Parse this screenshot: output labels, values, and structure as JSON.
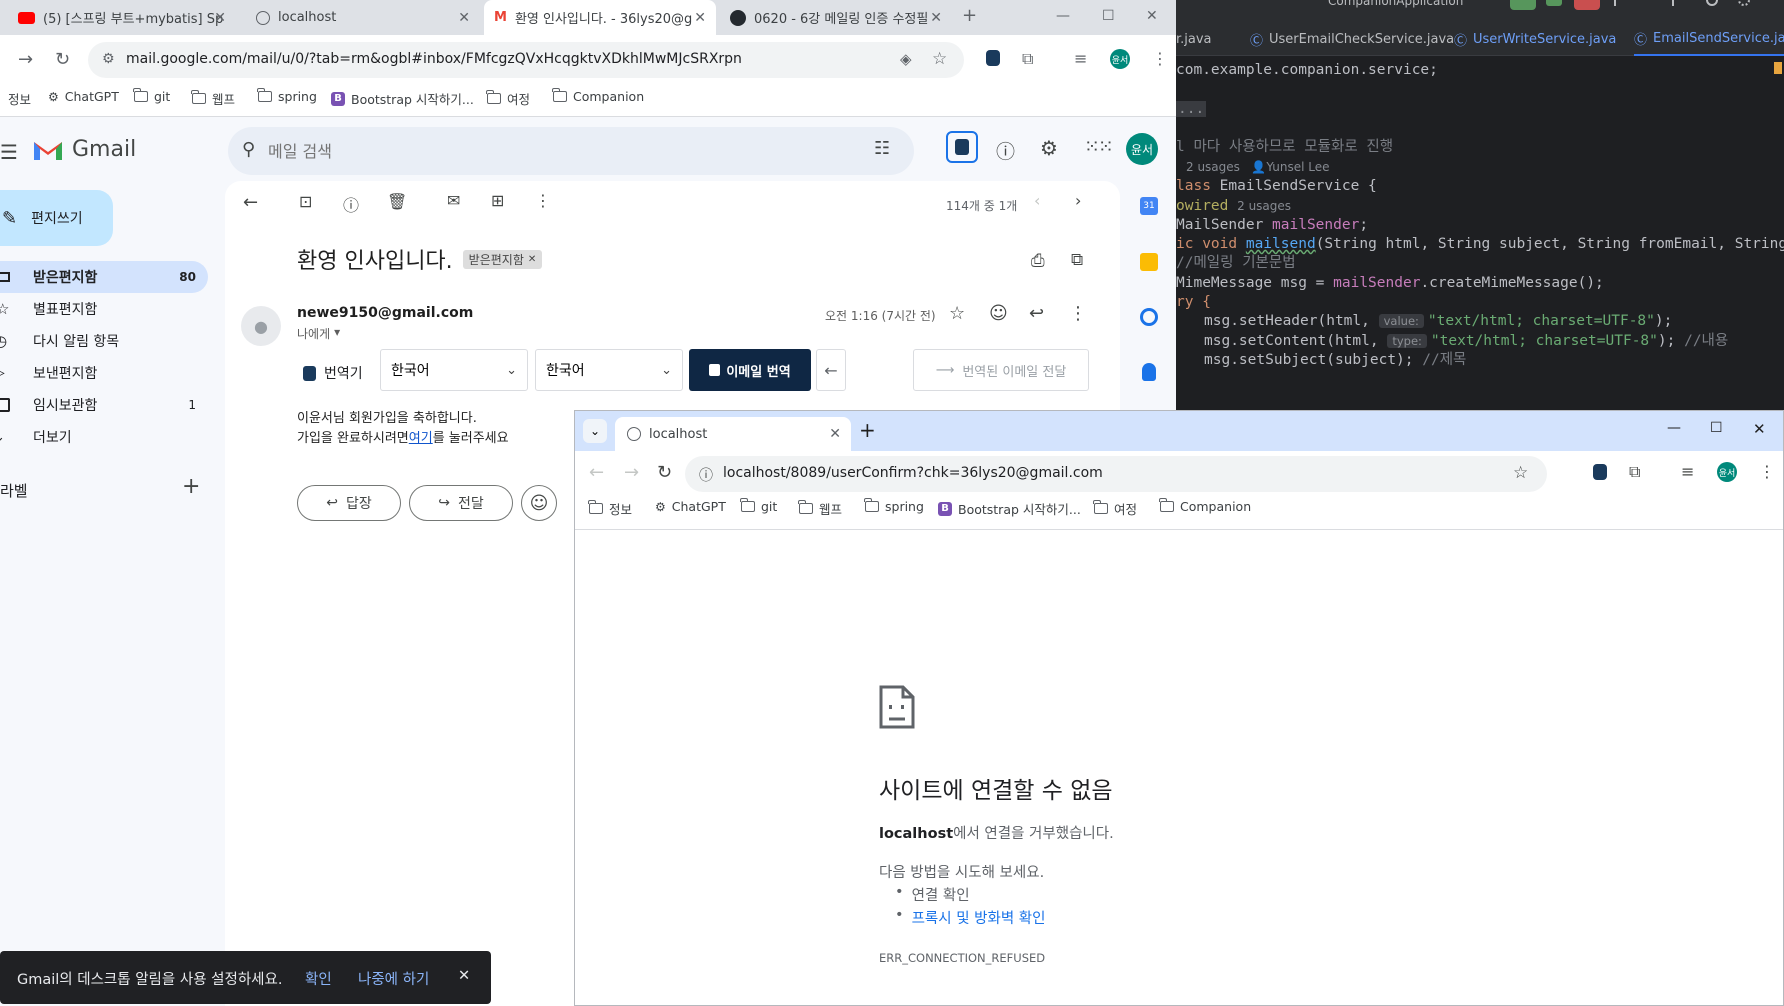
{
  "ide": {
    "run_config": "CompanionApplication",
    "tabs": [
      {
        "label": "r.java",
        "active": false
      },
      {
        "label": "UserEmailCheckService.java",
        "active": false
      },
      {
        "label": "UserWriteService.java",
        "active": false
      },
      {
        "label": "EmailSendService.java",
        "active": true
      }
    ],
    "code": {
      "package_kw": "",
      "package_name": "com.example.companion.service;",
      "fold_marker": "...",
      "comment_line": "l 마다 사용하므로 모듈화로 진행",
      "usages": "2 usages",
      "author": "Yunsel Lee",
      "class_kw": "lass",
      "class_name": "EmailSendService {",
      "autowired": "owired",
      "autowired_usages": "2 usages",
      "field_type": "MailSender ",
      "field_name": "mailSender",
      "field_end": ";",
      "method_kw": "ic void ",
      "method_name": "mailsend",
      "method_params": "(String html, String subject, String fromEmail, String toEmai",
      "comment2": "//메일링 기본문법",
      "mime_type": "MimeMessage msg = ",
      "mime_field": "mailSender",
      "mime_call": ".createMimeMessage();",
      "try_kw": "ry {",
      "set_header_call": "msg.setHeader(html, ",
      "set_header_hint": "value:",
      "set_header_str": "\"text/html; charset=UTF-8\"",
      "set_header_end": ");",
      "set_content_call": "msg.setContent(html, ",
      "set_content_hint": "type:",
      "set_content_str": "\"text/html; charset=UTF-8\"",
      "set_content_end": "); ",
      "set_content_comment": "//내용",
      "set_subject_call": "msg.setSubject(subject); ",
      "set_subject_comment": "//제목"
    }
  },
  "browser1": {
    "tabs": [
      {
        "label": "(5) [스프링 부트+mybatis] Spri",
        "icon": "youtube-icon"
      },
      {
        "label": "localhost",
        "icon": "globe-icon"
      },
      {
        "label": "환영 인사입니다. - 36lys20@g",
        "icon": "gmail-icon"
      },
      {
        "label": "0620 - 6강 메일링 인증 수정필",
        "icon": "github-icon"
      }
    ],
    "url": "mail.google.com/mail/u/0/?tab=rm&ogbl#inbox/FMfcgzQVxHcqgktvXDkhlMwMJcSRXrpn",
    "bookmarks": [
      "정보",
      "ChatGPT",
      "git",
      "웹프",
      "spring",
      "Bootstrap 시작하기...",
      "여정",
      "Companion"
    ],
    "avatar": "윤서"
  },
  "gmail": {
    "logo_text": "Gmail",
    "search_placeholder": "메일 검색",
    "compose": "편지쓰기",
    "sidebar": [
      {
        "label": "받은편지함",
        "count": "80",
        "icon": "inbox-icon",
        "active": true
      },
      {
        "label": "별표편지함",
        "count": "",
        "icon": "star-icon",
        "active": false
      },
      {
        "label": "다시 알림 항목",
        "count": "",
        "icon": "clock-icon",
        "active": false
      },
      {
        "label": "보낸편지함",
        "count": "",
        "icon": "send-icon",
        "active": false
      },
      {
        "label": "임시보관함",
        "count": "1",
        "icon": "draft-icon",
        "active": false
      },
      {
        "label": "더보기",
        "count": "",
        "icon": "chevron-down-icon",
        "active": false
      }
    ],
    "labels_header": "라벨",
    "pagination": "114개 중 1개",
    "subject": "환영 인사입니다.",
    "subject_badge": "받은편지함",
    "sender": "newe9150@gmail.com",
    "recipient": "나에게",
    "timestamp": "오전 1:16 (7시간 전)",
    "translator_label": "번역기",
    "lang_from": "한국어",
    "lang_to": "한국어",
    "translate_button": "이메일 번역",
    "forward_translated": "번역된 이메일 전달",
    "body_line1": "이윤서님 회원가입을 축하합니다.",
    "body_line2_prefix": "가입을 완료하시려면",
    "body_link": "여기",
    "body_line2_suffix": "를 눌러주세요",
    "reply": "답장",
    "forward": "전달",
    "snackbar_text": "Gmail의 데스크톱 알림을 사용 설정하세요.",
    "snackbar_ok": "확인",
    "snackbar_later": "나중에 하기"
  },
  "browser2": {
    "tab_label": "localhost",
    "url": "localhost/8089/userConfirm?chk=36lys20@gmail.com",
    "bookmarks": [
      "정보",
      "ChatGPT",
      "git",
      "웹프",
      "spring",
      "Bootstrap 시작하기...",
      "여정",
      "Companion"
    ],
    "avatar": "윤서",
    "error_title": "사이트에 연결할 수 없음",
    "error_host": "localhost",
    "error_desc_suffix": "에서 연결을 거부했습니다.",
    "try_header": "다음 방법을 시도해 보세요.",
    "suggestions": [
      "연결 확인",
      "프록시 및 방화벽 확인"
    ],
    "error_code": "ERR_CONNECTION_REFUSED"
  }
}
